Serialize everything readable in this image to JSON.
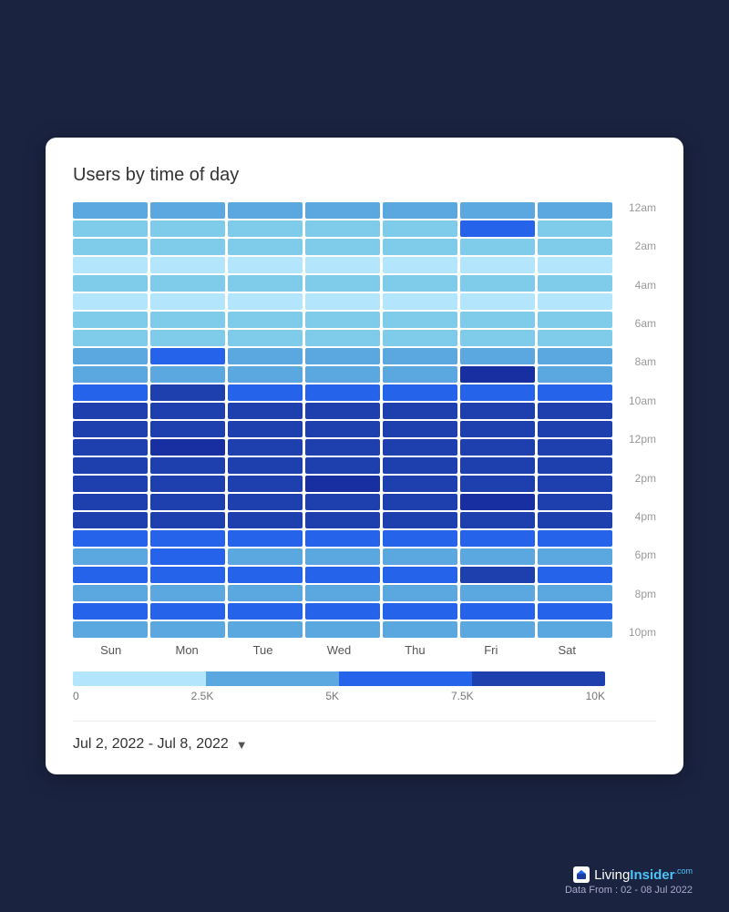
{
  "title": "Users by time of day",
  "days": [
    "Sun",
    "Mon",
    "Tue",
    "Wed",
    "Thu",
    "Fri",
    "Sat"
  ],
  "timeLabels": [
    "12am",
    "2am",
    "4am",
    "6am",
    "8am",
    "10am",
    "12pm",
    "2pm",
    "4pm",
    "6pm",
    "8pm",
    "10pm"
  ],
  "legendLabels": [
    "0",
    "2.5K",
    "5K",
    "7.5K",
    "10K"
  ],
  "legendColors": [
    "#87CEEB",
    "#5BA3D9",
    "#2563EB",
    "#1a3fa0"
  ],
  "dateRange": "Jul 2, 2022 - Jul 8, 2022",
  "footerText": "Data From : 02 - 08 Jul 2022",
  "brandName": "LivingInsider",
  "brandCom": ".com",
  "heatmap": [
    [
      3,
      3,
      3,
      3,
      3,
      3,
      3
    ],
    [
      2,
      2,
      2,
      2,
      2,
      4,
      2
    ],
    [
      2,
      2,
      2,
      2,
      2,
      2,
      2
    ],
    [
      1,
      1,
      1,
      1,
      1,
      1,
      1
    ],
    [
      2,
      2,
      2,
      2,
      2,
      2,
      2
    ],
    [
      1,
      1,
      1,
      1,
      1,
      1,
      1
    ],
    [
      2,
      2,
      2,
      2,
      2,
      2,
      2
    ],
    [
      2,
      2,
      2,
      2,
      2,
      2,
      2
    ],
    [
      3,
      4,
      3,
      3,
      3,
      3,
      3
    ],
    [
      3,
      3,
      3,
      3,
      3,
      6,
      3
    ],
    [
      4,
      5,
      4,
      4,
      4,
      4,
      4
    ],
    [
      5,
      5,
      5,
      5,
      5,
      5,
      5
    ],
    [
      5,
      5,
      5,
      5,
      5,
      5,
      5
    ],
    [
      5,
      6,
      5,
      5,
      5,
      5,
      5
    ],
    [
      5,
      5,
      5,
      5,
      5,
      5,
      5
    ],
    [
      5,
      5,
      5,
      6,
      5,
      5,
      5
    ],
    [
      5,
      5,
      5,
      5,
      5,
      6,
      5
    ],
    [
      5,
      5,
      5,
      5,
      5,
      5,
      5
    ],
    [
      4,
      4,
      4,
      4,
      4,
      4,
      4
    ],
    [
      3,
      4,
      3,
      3,
      3,
      3,
      3
    ],
    [
      4,
      4,
      4,
      4,
      4,
      5,
      4
    ],
    [
      3,
      3,
      3,
      3,
      3,
      3,
      3
    ],
    [
      4,
      4,
      4,
      4,
      4,
      4,
      4
    ],
    [
      3,
      3,
      3,
      3,
      3,
      3,
      3
    ]
  ]
}
